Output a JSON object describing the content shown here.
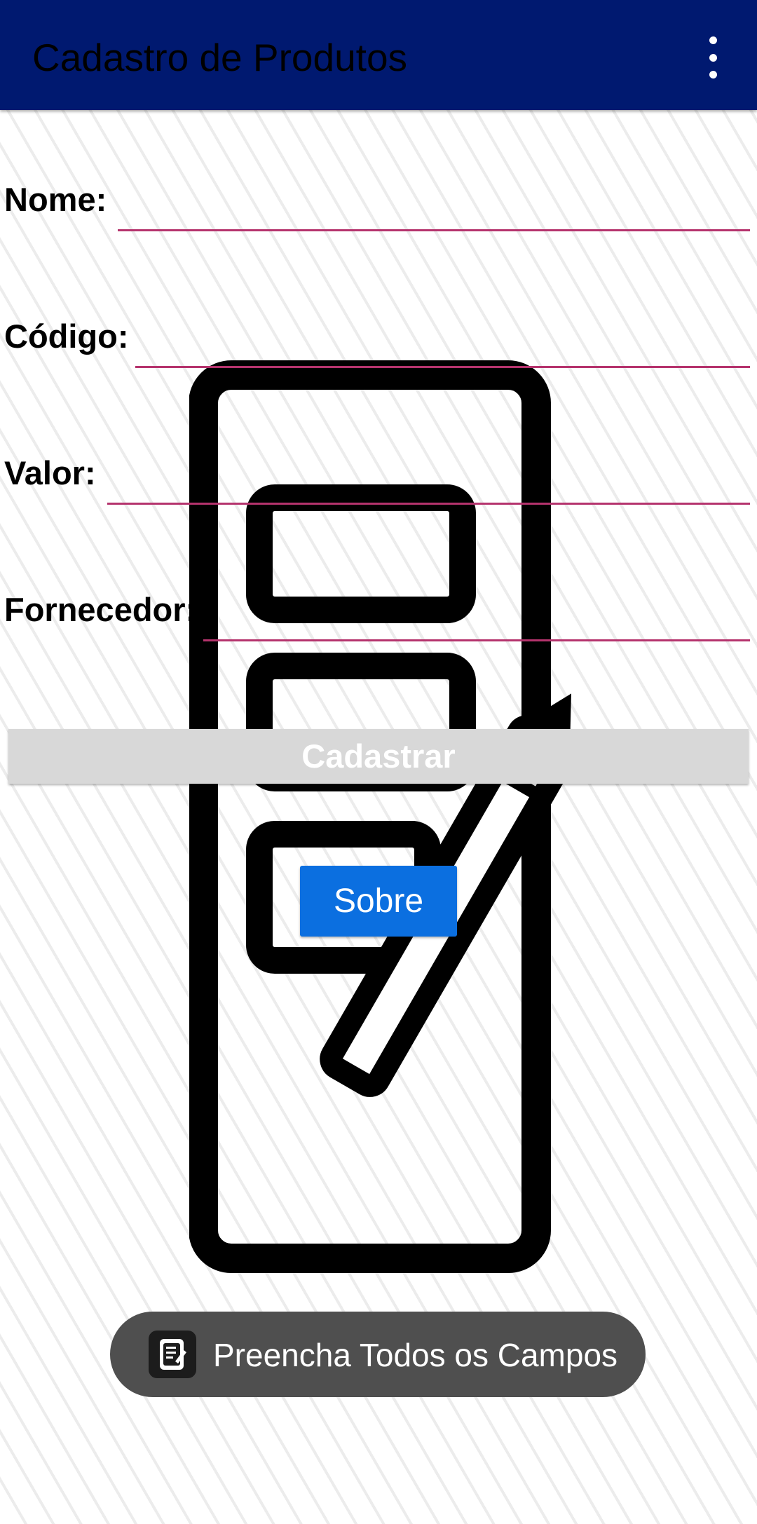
{
  "app_bar": {
    "title": "Cadastro de Produtos",
    "menu_icon": "more-vert-icon"
  },
  "background": {
    "graphic": "form-edit-document-icon"
  },
  "form": {
    "fields": [
      {
        "label": "Nome:",
        "value": ""
      },
      {
        "label": "Código:",
        "value": ""
      },
      {
        "label": "Valor:",
        "value": ""
      },
      {
        "label": "Fornecedor:",
        "value": ""
      }
    ],
    "underline_color": "#b5336d"
  },
  "buttons": {
    "cadastrar": "Cadastrar",
    "sobre": "Sobre"
  },
  "toast": {
    "icon": "form-app-icon",
    "message": "Preencha Todos os Campos"
  },
  "colors": {
    "app_bar": "#001970",
    "sobre_button": "#0b6fe0",
    "cadastrar_button": "#d8d8d8",
    "toast_bg": "#4f4f4f"
  }
}
